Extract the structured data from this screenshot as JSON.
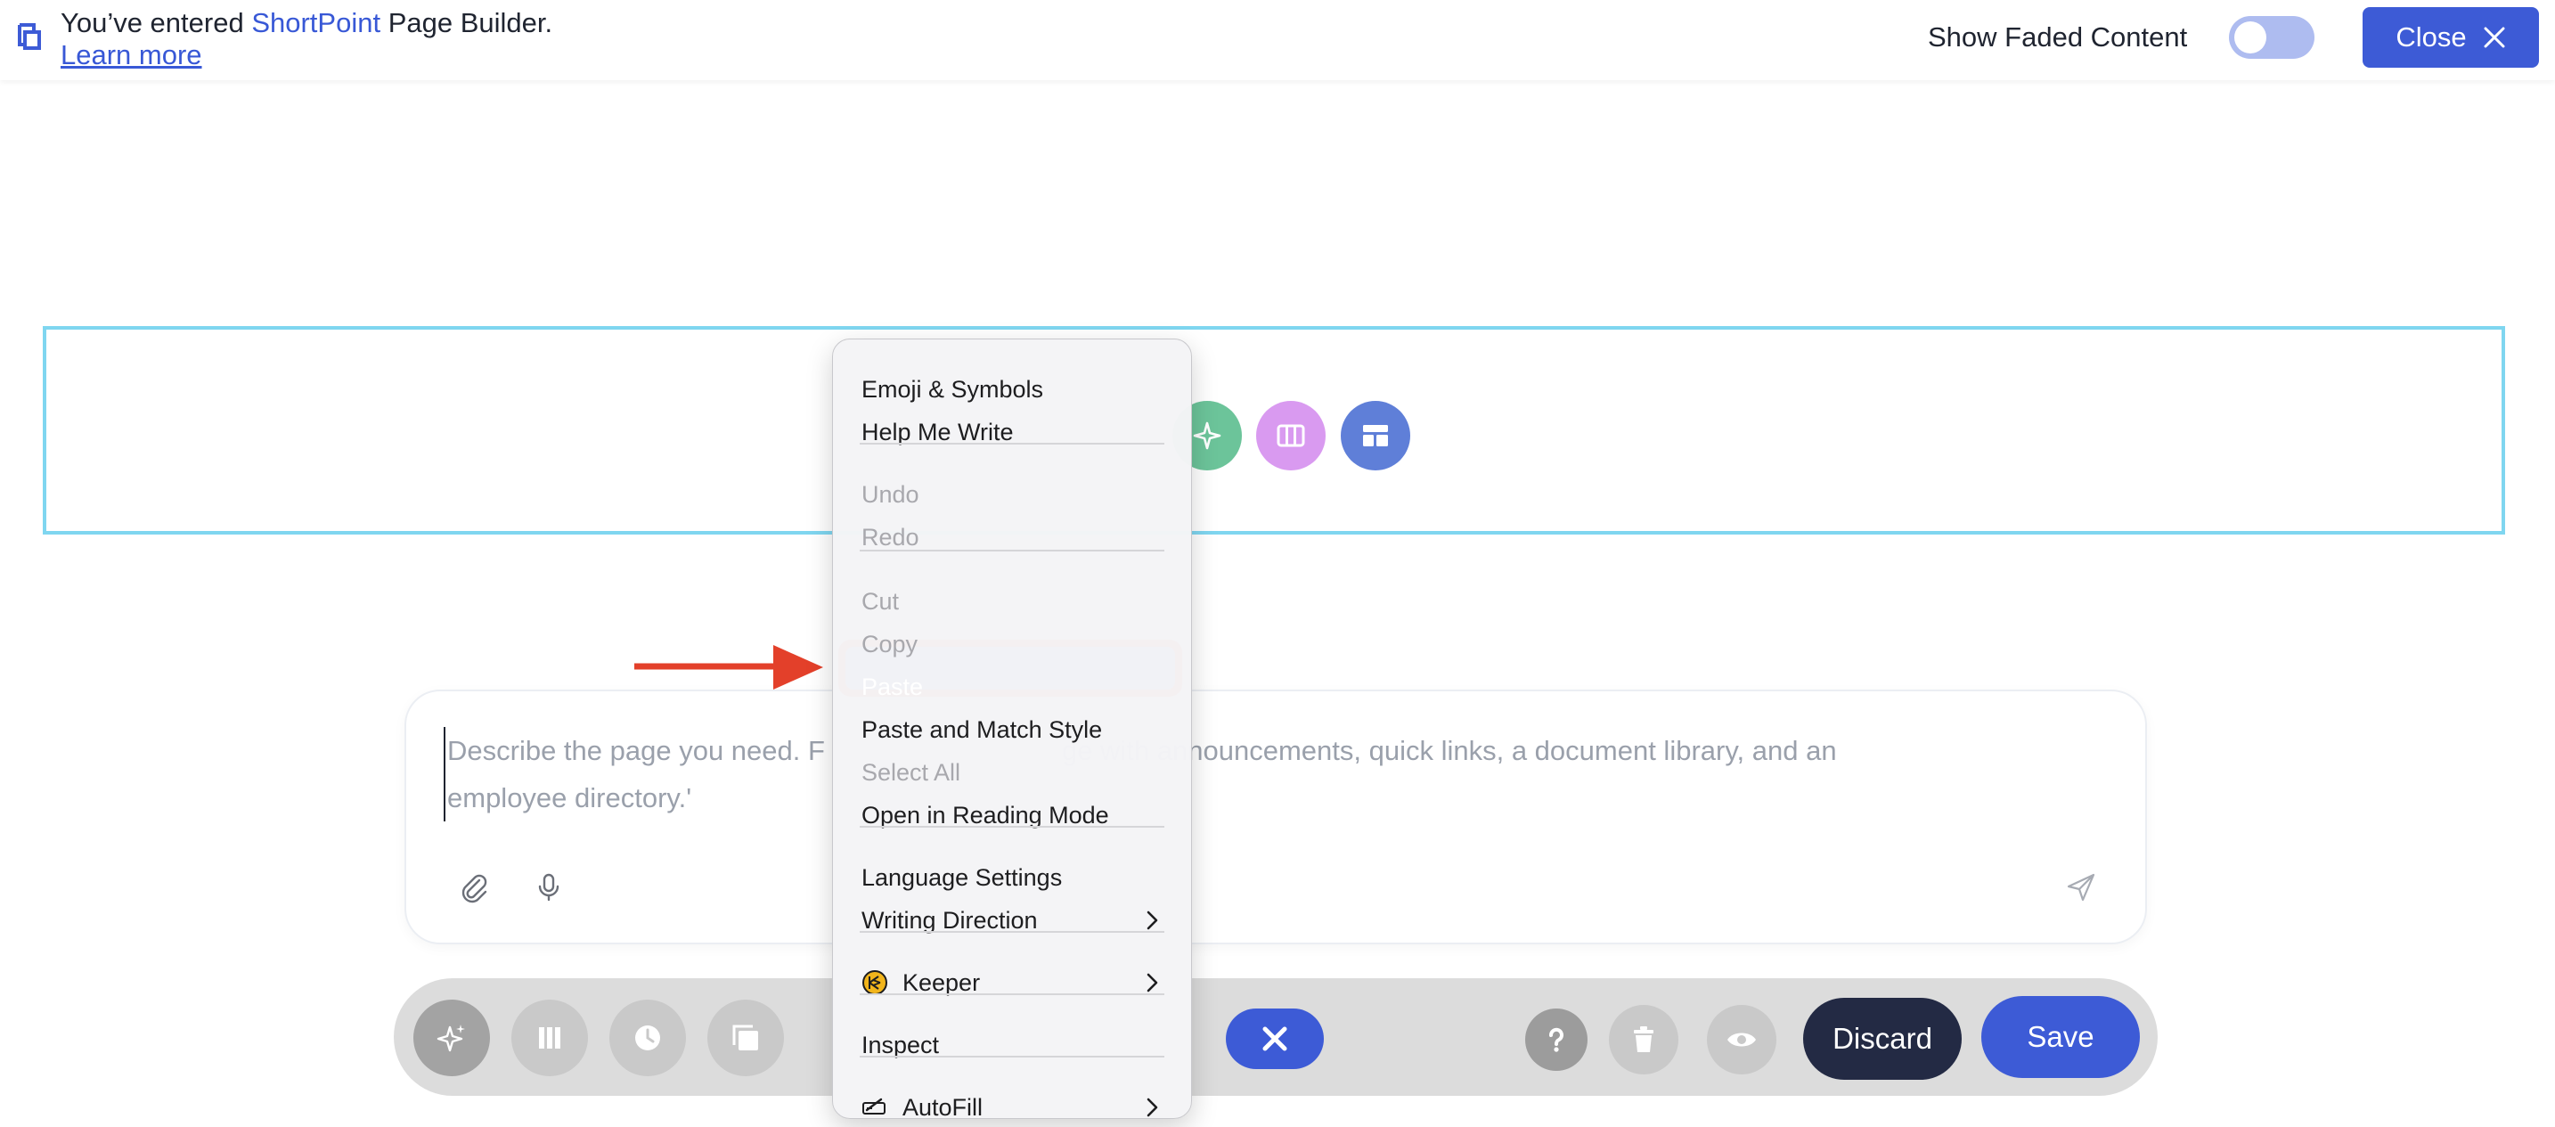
{
  "banner": {
    "prefix": "You’ve entered ",
    "brand": "ShortPoint",
    "suffix": " Page Builder.",
    "learn_more": "Learn more",
    "faded_label": "Show Faded Content",
    "faded_enabled": false,
    "close_label": "Close"
  },
  "section_actions": [
    {
      "icon": "sparkle-icon",
      "color": "#6cc49a"
    },
    {
      "icon": "columns-icon",
      "color": "#d99af0"
    },
    {
      "icon": "layout-icon",
      "color": "#5f7fd8"
    }
  ],
  "prompt": {
    "placeholder_line1": "Describe the page you need. F",
    "placeholder_line1_end": "ge with announcements, quick links, a document library, and an",
    "placeholder_line2": "employee directory.'"
  },
  "toolbar": {
    "discard_label": "Discard",
    "save_label": "Save"
  },
  "context_menu": {
    "items": [
      {
        "label": "Emoji & Symbols",
        "disabled": false
      },
      {
        "label": "Help Me Write",
        "disabled": false
      },
      {
        "label": "Undo",
        "disabled": true
      },
      {
        "label": "Redo",
        "disabled": true
      },
      {
        "label": "Cut",
        "disabled": true
      },
      {
        "label": "Copy",
        "disabled": true
      },
      {
        "label": "Paste",
        "disabled": false,
        "selected": true
      },
      {
        "label": "Paste and Match Style",
        "disabled": false
      },
      {
        "label": "Select All",
        "disabled": true
      },
      {
        "label": "Open in Reading Mode",
        "disabled": false
      },
      {
        "label": "Language Settings",
        "disabled": false
      },
      {
        "label": "Writing Direction",
        "disabled": false,
        "submenu": true
      },
      {
        "label": "Keeper",
        "disabled": false,
        "submenu": true,
        "icon": "keeper-icon"
      },
      {
        "label": "Inspect",
        "disabled": false
      },
      {
        "label": "AutoFill",
        "disabled": false,
        "submenu": true,
        "icon": "autofill-icon"
      }
    ]
  },
  "colors": {
    "accent": "#3d5bd6",
    "highlight_ring": "#d94028",
    "selection": "#6a9ef6",
    "section_border": "#7fd6f0"
  }
}
